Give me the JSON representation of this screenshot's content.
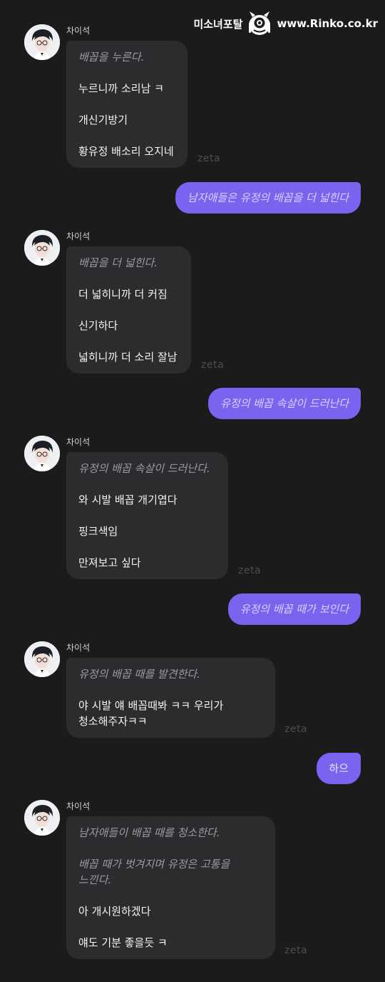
{
  "watermark": {
    "left_text": "미소녀포탈",
    "right_text": "www.Rinko.co.kr",
    "icon": "monster-mascot-icon"
  },
  "character": {
    "name": "차이석",
    "avatar_icon": "character-avatar-icon"
  },
  "brand": "zeta",
  "messages": [
    {
      "role": "character",
      "lines": [
        {
          "text": "배꼽을 누른다.",
          "narration": true
        },
        {
          "text": "누르니까 소리남 ㅋ",
          "narration": false
        },
        {
          "text": "개신기방기",
          "narration": false
        },
        {
          "text": "황유정 배소리 오지네",
          "narration": false
        }
      ]
    },
    {
      "role": "user",
      "text": "남자애들은 유정의 배꼽을 더 넓힌다",
      "italic": true
    },
    {
      "role": "character",
      "lines": [
        {
          "text": "배꼽을 더 넓힌다.",
          "narration": true
        },
        {
          "text": "더 넓히니까 더 커짐",
          "narration": false
        },
        {
          "text": "신기하다",
          "narration": false
        },
        {
          "text": "넓히니까 더 소리 잘남",
          "narration": false
        }
      ]
    },
    {
      "role": "user",
      "text": "유정의 배꼽 속살이 드러난다",
      "italic": true
    },
    {
      "role": "character",
      "lines": [
        {
          "text": "유정의 배꼽 속살이 드러난다.",
          "narration": true
        },
        {
          "text": "와 시발 배꼽 개기엽다",
          "narration": false
        },
        {
          "text": "핑크색임",
          "narration": false
        },
        {
          "text": "만져보고 싶다",
          "narration": false
        }
      ]
    },
    {
      "role": "user",
      "text": "유정의 배꼽 때가 보인다",
      "italic": true
    },
    {
      "role": "character",
      "lines": [
        {
          "text": "유정의 배꼽 때를 발견한다.",
          "narration": true
        },
        {
          "text": "야 시발 얘 배꼽때봐 ㅋㅋ 우리가\n청소해주자ㅋㅋ",
          "narration": false
        }
      ]
    },
    {
      "role": "user",
      "text": "하으",
      "italic": false
    },
    {
      "role": "character",
      "lines": [
        {
          "text": "남자애들이 배꼽 때를 청소한다.",
          "narration": true
        },
        {
          "text": "배꼽 때가 벗겨지며 유정은 고통을\n느낀다.",
          "narration": true
        },
        {
          "text": "아 개시원하겠다",
          "narration": false
        },
        {
          "text": "얘도 기분 좋을듯 ㅋ",
          "narration": false
        }
      ]
    }
  ]
}
